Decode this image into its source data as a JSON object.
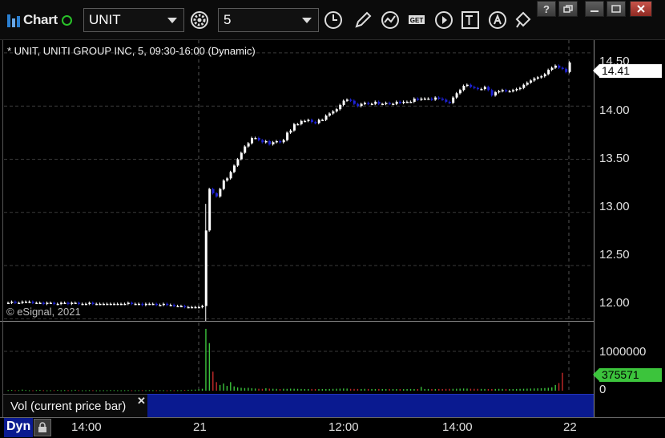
{
  "toolbar": {
    "app_label": "Chart",
    "symbol_value": "UNIT",
    "interval_value": "5",
    "icons": [
      "settings-gear-icon",
      "time-clock-icon",
      "draw-pencil-icon",
      "study-icon",
      "get-data-icon",
      "play-icon",
      "text-tool-icon",
      "alert-icon",
      "move-tool-icon"
    ]
  },
  "window_buttons": [
    "?",
    "restore",
    "minimize",
    "close"
  ],
  "chart": {
    "title": "* UNIT, UNITI GROUP INC, 5, 09:30-16:00 (Dynamic)",
    "copyright": "© eSignal, 2021",
    "last_price_label": "14.41",
    "volume_last_label": "375571",
    "study_label": "Vol (current price bar)",
    "dyn_label": "Dyn",
    "colors": {
      "up": "#ffffff",
      "down": "#1e22d6",
      "vol_up": "#3cc43c",
      "vol_down": "#c42a2a",
      "grid": "#3a3a3a",
      "study_bar": "#0a1a90"
    }
  },
  "chart_data": {
    "type": "candlestick",
    "ylim": [
      11.98,
      14.62
    ],
    "y_ticks": [
      "14.50",
      "14.00",
      "13.50",
      "13.00",
      "12.50",
      "12.00"
    ],
    "x_ticks": [
      "14:00",
      "21",
      "12:00",
      "14:00",
      "22"
    ],
    "session_breaks": [
      "21",
      "22"
    ],
    "close": [
      12.15,
      12.16,
      12.15,
      12.15,
      12.16,
      12.16,
      12.16,
      12.15,
      12.15,
      12.15,
      12.14,
      12.15,
      12.15,
      12.14,
      12.14,
      12.15,
      12.15,
      12.14,
      12.15,
      12.15,
      12.14,
      12.14,
      12.14,
      12.15,
      12.14,
      12.14,
      12.14,
      12.14,
      12.14,
      12.14,
      12.14,
      12.14,
      12.14,
      12.14,
      12.15,
      12.14,
      12.14,
      12.14,
      12.13,
      12.14,
      12.14,
      12.14,
      12.13,
      12.13,
      12.14,
      12.13,
      12.13,
      12.12,
      12.12,
      12.12,
      12.11,
      12.11,
      12.11,
      12.11,
      12.11,
      12.12,
      12.83,
      13.22,
      13.18,
      13.15,
      13.22,
      13.3,
      13.32,
      13.38,
      13.44,
      13.5,
      13.56,
      13.62,
      13.65,
      13.7,
      13.7,
      13.68,
      13.66,
      13.67,
      13.64,
      13.66,
      13.67,
      13.66,
      13.68,
      13.75,
      13.77,
      13.83,
      13.83,
      13.86,
      13.86,
      13.87,
      13.85,
      13.84,
      13.87,
      13.87,
      13.91,
      13.93,
      13.95,
      13.97,
      14.01,
      14.05,
      14.06,
      14.05,
      14.02,
      14.0,
      14.02,
      14.03,
      14.02,
      14.02,
      14.04,
      14.02,
      14.02,
      14.03,
      14.02,
      14.02,
      14.04,
      14.03,
      14.04,
      14.04,
      14.04,
      14.07,
      14.06,
      14.07,
      14.07,
      14.07,
      14.06,
      14.08,
      14.07,
      14.06,
      14.04,
      14.03,
      14.08,
      14.12,
      14.15,
      14.19,
      14.2,
      14.18,
      14.17,
      14.16,
      14.16,
      14.18,
      14.15,
      14.1,
      14.13,
      14.14,
      14.15,
      14.14,
      14.14,
      14.15,
      14.16,
      14.17,
      14.2,
      14.22,
      14.24,
      14.26,
      14.27,
      14.28,
      14.3,
      14.34,
      14.36,
      14.38,
      14.36,
      14.35,
      14.32,
      14.41
    ],
    "volume": [
      12000,
      15000,
      10000,
      11000,
      22000,
      14000,
      9000,
      8000,
      12000,
      16000,
      10000,
      8000,
      9000,
      11000,
      15000,
      8000,
      12000,
      10000,
      9000,
      18000,
      10000,
      8000,
      9000,
      11000,
      10000,
      7000,
      8000,
      9000,
      10000,
      12000,
      11000,
      9000,
      8000,
      10000,
      12000,
      9000,
      8000,
      10000,
      11000,
      9000,
      12000,
      10000,
      9000,
      11000,
      10000,
      8000,
      12000,
      9000,
      10000,
      11000,
      15000,
      18000,
      20000,
      22000,
      30000,
      40000,
      1300000,
      1000000,
      400000,
      180000,
      120000,
      150000,
      100000,
      180000,
      90000,
      70000,
      60000,
      55000,
      60000,
      50000,
      45000,
      40000,
      38000,
      50000,
      42000,
      40000,
      38000,
      35000,
      40000,
      38000,
      42000,
      40000,
      38000,
      36000,
      35000,
      34000,
      36000,
      35000,
      33000,
      34000,
      35000,
      36000,
      38000,
      40000,
      42000,
      45000,
      43000,
      38000,
      37000,
      36000,
      35000,
      38000,
      36000,
      35000,
      34000,
      36000,
      35000,
      34000,
      36000,
      35000,
      34000,
      33000,
      32000,
      34000,
      36000,
      35000,
      34000,
      80000,
      34000,
      36000,
      35000,
      34000,
      36000,
      35000,
      37000,
      38000,
      39000,
      40000,
      42000,
      45000,
      43000,
      40000,
      39000,
      38000,
      37000,
      36000,
      35000,
      34000,
      36000,
      38000,
      37000,
      36000,
      35000,
      34000,
      36000,
      38000,
      40000,
      42000,
      44000,
      46000,
      48000,
      50000,
      55000,
      60000,
      70000,
      120000,
      160000,
      375571
    ]
  }
}
